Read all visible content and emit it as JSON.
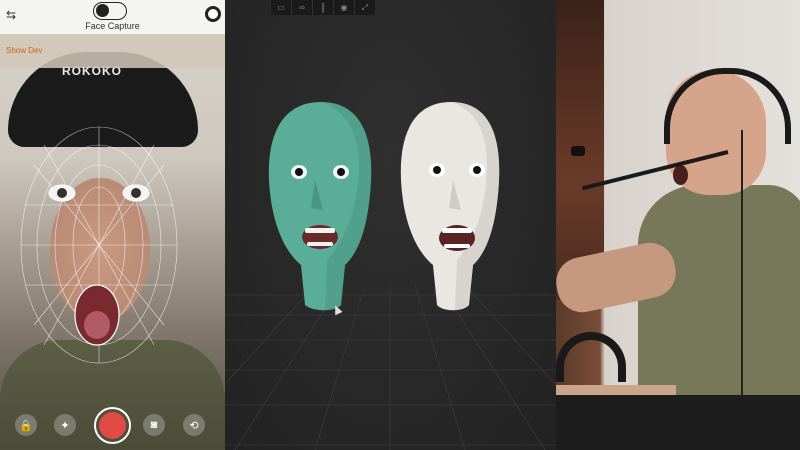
{
  "left_app": {
    "title": "Face Capture",
    "helmet_brand": "ROKOKO",
    "show_dev_label": "Show Dev",
    "icons": {
      "settings": "sliders-icon",
      "mode_toggle": "face-toggle-icon",
      "record_indicator": "record-indicator-icon",
      "lock": "lock-icon",
      "body": "body-icon",
      "record": "record-button-icon",
      "camera": "camera-icon",
      "switch": "switch-camera-icon"
    },
    "record_color": "#e04b43",
    "show_dev_color": "#d06010"
  },
  "viewport": {
    "toolbar_icons": [
      "monitor-icon",
      "link-icon",
      "columns-icon",
      "eye-icon",
      "expand-icon"
    ],
    "head_colors": {
      "left": "#5aae98",
      "right": "#e9e7e1"
    }
  }
}
